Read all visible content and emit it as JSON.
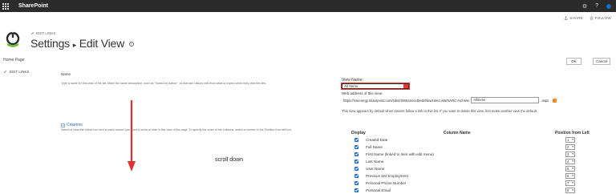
{
  "suitebar": {
    "brand": "SharePoint",
    "help_glyph": "?",
    "settings_glyph": "⚙"
  },
  "actions": {
    "share": "SHARE",
    "follow": "FOLLOW"
  },
  "header": {
    "edit_links": "EDIT LINKS",
    "title_part1": "Settings",
    "separator": "▸",
    "title_part2": "Edit View",
    "info_glyph": "i"
  },
  "leftnav": {
    "items": [
      {
        "label": "Home Page"
      },
      {
        "label": "EDIT LINKS"
      }
    ]
  },
  "buttons": {
    "ok": "OK",
    "cancel": "Cancel"
  },
  "name_section": {
    "label": "Name",
    "description": "Type a name for this view of the list. Make the name descriptive, such as \"Sorted by Author\", so that site visitors will know what to expect when they click this link.",
    "view_name_label": "View Name:",
    "view_name_value": "All Items",
    "web_address_label": "Web address of this view:",
    "url_prefix": "https://smenergy.sharepoint.com/sites/SMServiceDesk/NewHire/Lists/NARC Archive/",
    "url_value": "AllItems",
    "url_suffix": ".aspx",
    "default_note": "This view appears by default when visitors follow a link to this list. If you want to delete this view, first make another view the default."
  },
  "columns_section": {
    "title": "Columns",
    "description": "Select or clear the check box next to each column you want to show or hide in this view of the page. To specify the order of the columns, select a number in the Position from left box.",
    "headers": {
      "display": "Display",
      "column_name": "Column Name",
      "position": "Position from Left"
    },
    "rows": [
      {
        "name": "Created Date",
        "position": "1"
      },
      {
        "name": "Full Name",
        "position": "2"
      },
      {
        "name": "First Name (linked to item with edit menu)",
        "position": "3"
      },
      {
        "name": "Last Name",
        "position": "4"
      },
      {
        "name": "User Name",
        "position": "5"
      },
      {
        "name": "Previous SM Employment",
        "position": "6"
      },
      {
        "name": "Personal Phone Number",
        "position": "7"
      },
      {
        "name": "Personal Email",
        "position": "8"
      }
    ]
  },
  "annotation": {
    "scroll_note": "scroll down",
    "arrow_color": "#e03131"
  }
}
